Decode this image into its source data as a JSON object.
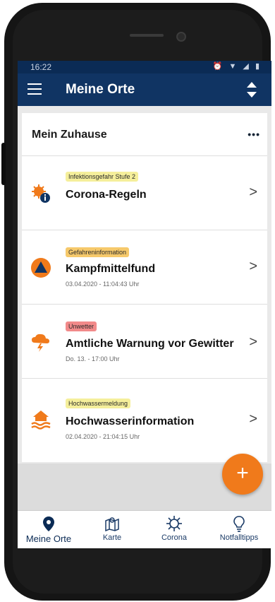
{
  "status_bar": {
    "time": "16:22",
    "icons": "⏰ ▼ ◢ ▮"
  },
  "app_bar": {
    "title": "Meine Orte"
  },
  "places": {
    "heading": "Mein Zuhause",
    "more_label": "•••",
    "items": [
      {
        "badge": "Infektionsgefahr Stufe 2",
        "badge_color": "#f5ef9b",
        "title": "Corona-Regeln",
        "date": "",
        "icon": "corona-virus-info-icon",
        "chevron": ">"
      },
      {
        "badge": "Gefahreninformation",
        "badge_color": "#f6c96b",
        "title": "Kampfmittelfund",
        "date": "03.04.2020 - 11:04:43 Uhr",
        "icon": "warning-triangle-icon",
        "chevron": ">"
      },
      {
        "badge": "Unwetter",
        "badge_color": "#f28a8a",
        "title": "Amtliche Warnung vor Gewitter",
        "date": "Do. 13. - 17:00 Uhr",
        "icon": "thunderstorm-icon",
        "chevron": ">"
      },
      {
        "badge": "Hochwassermeldung",
        "badge_color": "#f5ef9b",
        "title": "Hochwasserinformation",
        "date": "02.04.2020 - 21:04:15 Uhr",
        "icon": "flood-icon",
        "chevron": ">"
      }
    ]
  },
  "fab": {
    "label": "+"
  },
  "nav": [
    {
      "label": "Meine Orte",
      "icon": "location-pin-icon",
      "active": true
    },
    {
      "label": "Karte",
      "icon": "map-icon",
      "active": false
    },
    {
      "label": "Corona",
      "icon": "virus-icon",
      "active": false
    },
    {
      "label": "Notfalltipps",
      "icon": "lightbulb-icon",
      "active": false
    }
  ],
  "colors": {
    "header": "#103463",
    "status": "#0b2b55",
    "accent": "#f07a1b"
  }
}
